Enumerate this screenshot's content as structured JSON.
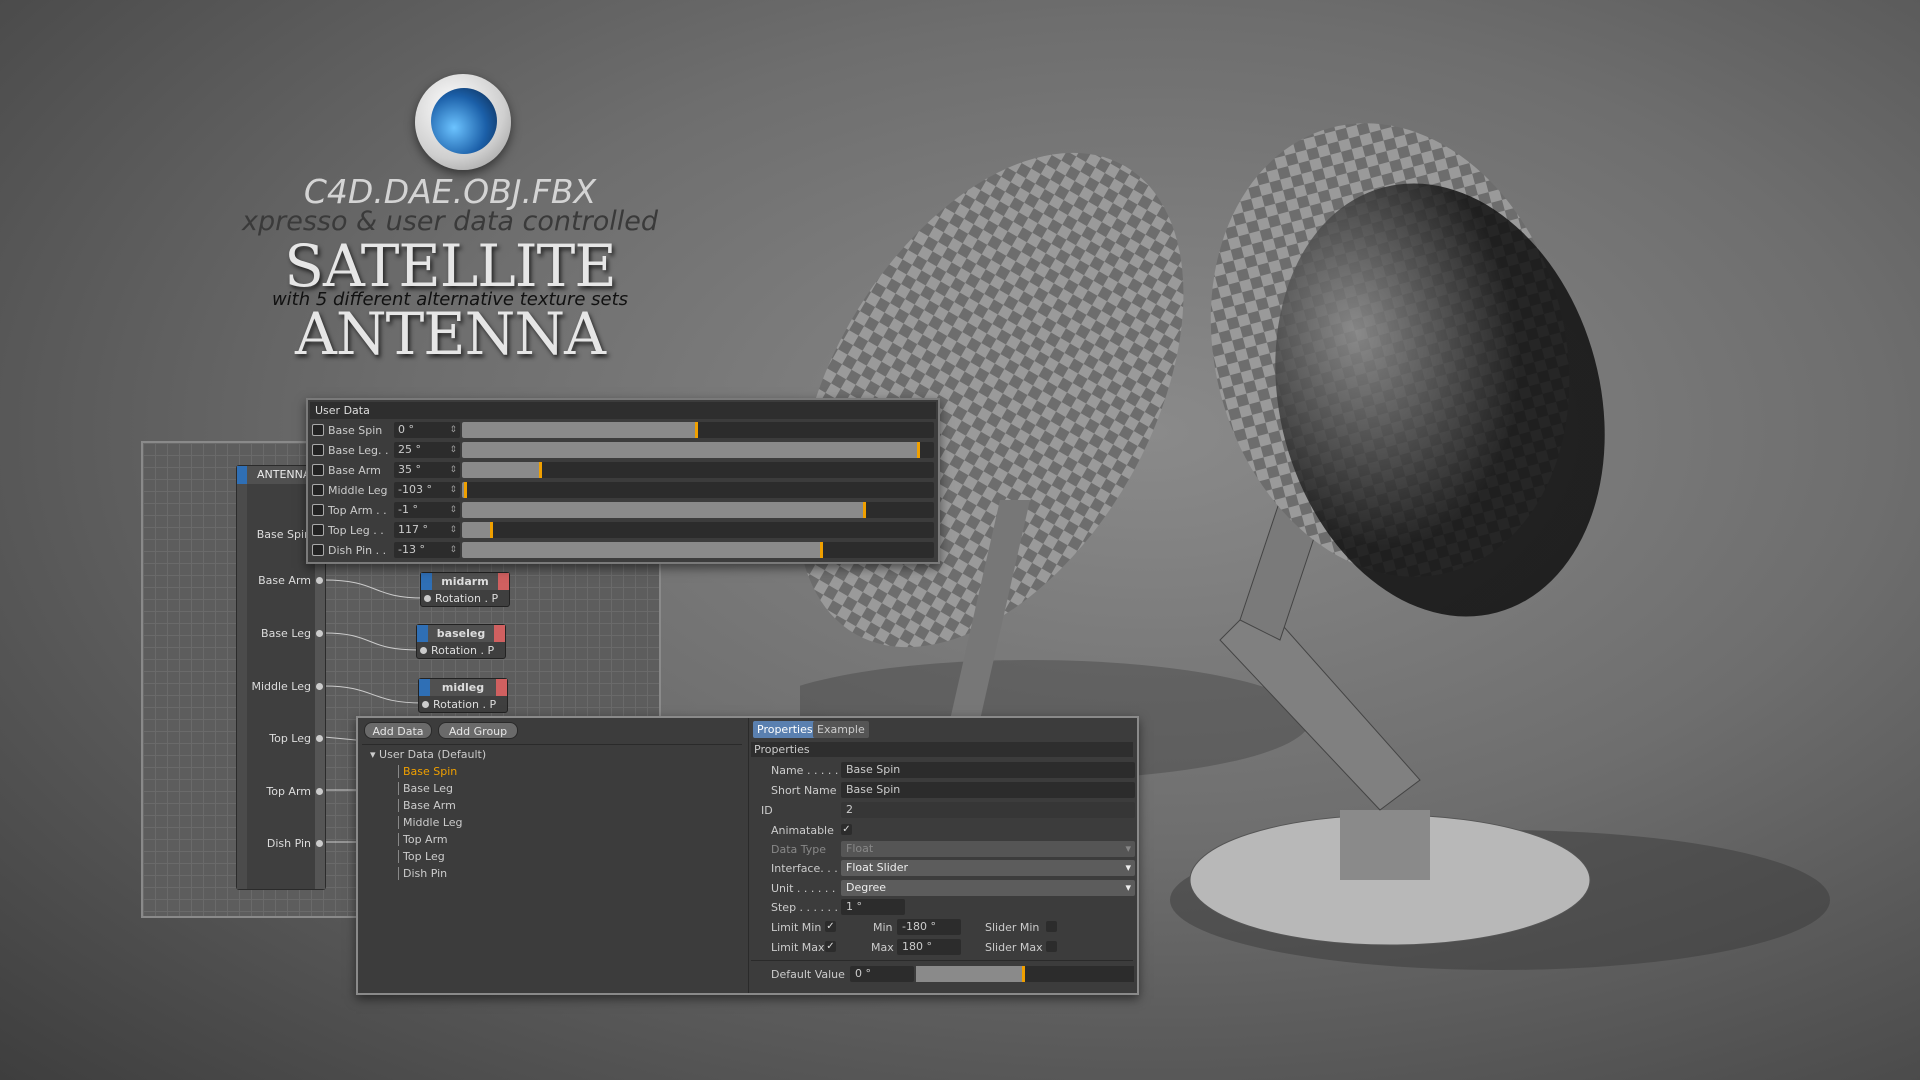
{
  "promo": {
    "logo": "cinema-4d-logo",
    "formats": "C4D.DAE.OBJ.FBX",
    "tagline": "xpresso & user data controlled",
    "title": "SATELLITE ANTENNA",
    "subtitle": "with 5 different alternative texture sets"
  },
  "xpresso": {
    "object_node": "ANTENNA",
    "ports": [
      "Base Spin",
      "Base Arm",
      "Base Leg",
      "Middle Leg",
      "Top Leg",
      "Top Arm",
      "Dish Pin"
    ],
    "target_nodes": [
      {
        "name": "midarm",
        "port": "Rotation . P"
      },
      {
        "name": "baseleg",
        "port": "Rotation . P"
      },
      {
        "name": "midleg",
        "port": "Rotation . P"
      }
    ]
  },
  "user_data": {
    "title": "User Data",
    "accent": "#f0a000",
    "rows": [
      {
        "label": "Base Spin",
        "value": "0 °",
        "fill": 0.5
      },
      {
        "label": "Base Leg. .",
        "value": "25 °",
        "fill": 0.97
      },
      {
        "label": "Base Arm",
        "value": "35 °",
        "fill": 0.17
      },
      {
        "label": "Middle Leg",
        "value": "-103 °",
        "fill": 0.01
      },
      {
        "label": "Top Arm . .",
        "value": "-1 °",
        "fill": 0.855
      },
      {
        "label": "Top Leg . .",
        "value": "117 °",
        "fill": 0.065
      },
      {
        "label": "Dish Pin . .",
        "value": "-13 °",
        "fill": 0.765
      }
    ]
  },
  "manager": {
    "add_data": "Add Data",
    "add_group": "Add Group",
    "root": "User Data (Default)",
    "items": [
      "Base Spin",
      "Base Leg",
      "Base Arm",
      "Middle Leg",
      "Top Arm",
      "Top Leg",
      "Dish Pin"
    ],
    "selected": "Base Spin",
    "tabs": [
      "Properties",
      "Example"
    ],
    "section": "Properties",
    "props": {
      "name_label": "Name . . . . .",
      "name": "Base Spin",
      "short_label": "Short Name",
      "short": "Base Spin",
      "id_label": "ID",
      "id": "2",
      "anim_label": "Animatable",
      "animatable": true,
      "type_label": "Data Type",
      "type": "Float",
      "iface_label": "Interface. . .",
      "iface": "Float Slider",
      "unit_label": "Unit . . . . . .",
      "unit": "Degree",
      "step_label": "Step . . . . . .",
      "step": "1 °",
      "limmin_label": "Limit Min",
      "limit_min": true,
      "min_label": "Min",
      "min": "-180 °",
      "slmin_label": "Slider Min",
      "slider_min": false,
      "limmax_label": "Limit Max",
      "limit_max": true,
      "max_label": "Max",
      "max": "180 °",
      "slmax_label": "Slider Max",
      "slider_max": false,
      "default_label": "Default Value",
      "default": "0 °",
      "default_fill": 0.5
    }
  }
}
